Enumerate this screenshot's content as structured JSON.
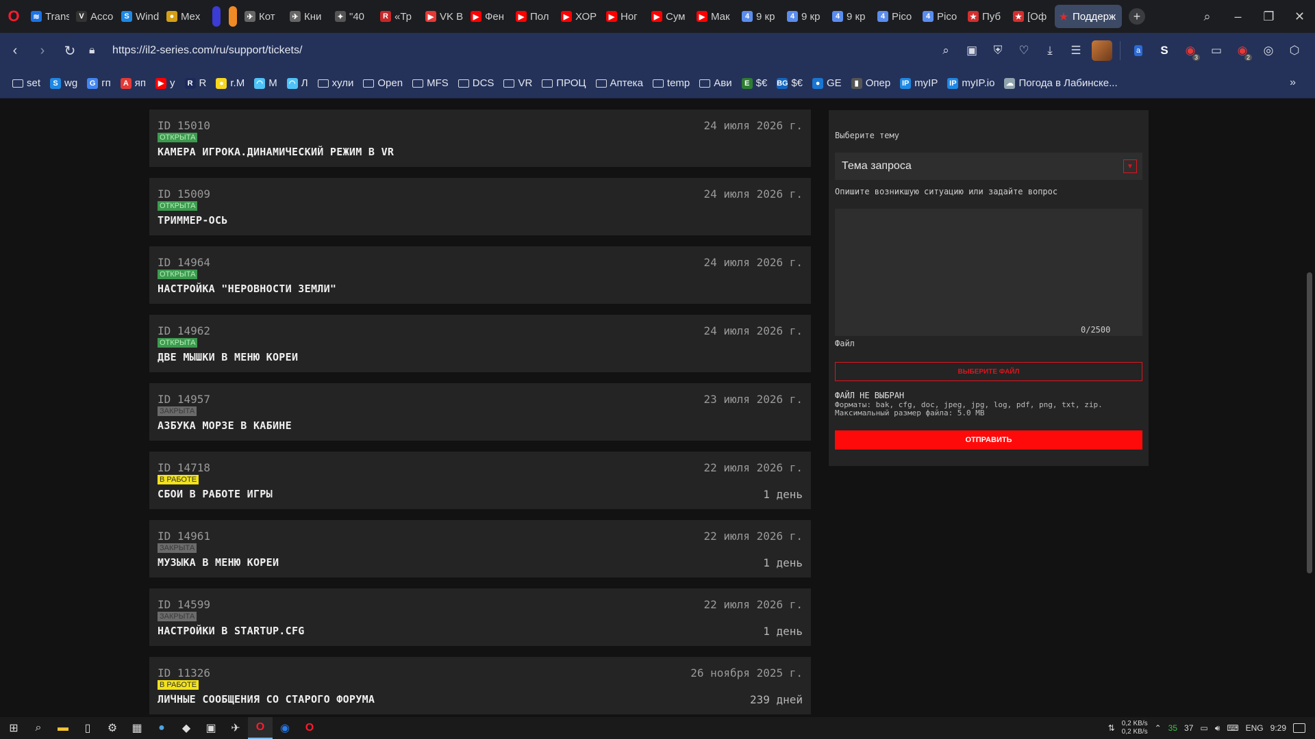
{
  "browser": {
    "tabs": [
      {
        "label": "Trans",
        "icon": "wifi-icon",
        "color": "#1a73e8"
      },
      {
        "label": "Acco",
        "icon": "vpn-icon",
        "color": "#333333"
      },
      {
        "label": "Wind",
        "icon": "wg-icon",
        "color": "#1e88e5"
      },
      {
        "label": "Mex",
        "icon": "coin-icon",
        "color": "#d4a017"
      },
      {
        "label": "",
        "icon": "pill",
        "color": "#3b3bd6"
      },
      {
        "label": "",
        "icon": "pill",
        "color": "#f08a24"
      },
      {
        "label": "Кот",
        "icon": "plane-icon",
        "color": "#666666"
      },
      {
        "label": "Кни",
        "icon": "plane-icon",
        "color": "#666666"
      },
      {
        "label": "\"40",
        "icon": "star4-icon",
        "color": "#555555"
      },
      {
        "label": "«Тр",
        "icon": "r-icon",
        "color": "#c62828"
      },
      {
        "label": "VK В",
        "icon": "play-icon",
        "color": "#e53935"
      },
      {
        "label": "Фен",
        "icon": "youtube-icon",
        "color": "#ff0000"
      },
      {
        "label": "Пол",
        "icon": "youtube-icon",
        "color": "#ff0000"
      },
      {
        "label": "ХОР",
        "icon": "youtube-icon",
        "color": "#ff0000"
      },
      {
        "label": "Ног",
        "icon": "youtube-icon",
        "color": "#ff0000"
      },
      {
        "label": "Сум",
        "icon": "youtube-icon",
        "color": "#ff0000"
      },
      {
        "label": "Мак",
        "icon": "youtube-icon",
        "color": "#ff0000"
      },
      {
        "label": "9 кр",
        "icon": "four-icon",
        "color": "#5b8def"
      },
      {
        "label": "9 кр",
        "icon": "four-icon",
        "color": "#5b8def"
      },
      {
        "label": "9 кр",
        "icon": "four-icon",
        "color": "#5b8def"
      },
      {
        "label": "Pico",
        "icon": "four-icon",
        "color": "#5b8def"
      },
      {
        "label": "Pico",
        "icon": "four-icon",
        "color": "#5b8def"
      },
      {
        "label": "Пуб",
        "icon": "red-star-icon",
        "color": "#d32f2f"
      },
      {
        "label": "[Оф",
        "icon": "red-star-icon",
        "color": "#d32f2f"
      }
    ],
    "active_tab": {
      "label": "Поддерж",
      "icon": "red-star-icon"
    },
    "url": "https://il2-series.com/ru/support/tickets/",
    "extension_badges": {
      "ext1": "3",
      "ext2": "2"
    }
  },
  "bookmarks": [
    {
      "label": "set",
      "type": "folder"
    },
    {
      "label": "wg",
      "type": "icon",
      "color": "#1e88e5",
      "glyph": "S"
    },
    {
      "label": "гп",
      "type": "icon",
      "color": "#4285f4",
      "glyph": "G"
    },
    {
      "label": "яп",
      "type": "icon",
      "color": "#e53935",
      "glyph": "A"
    },
    {
      "label": "у",
      "type": "icon",
      "color": "#ff0000",
      "glyph": "▶"
    },
    {
      "label": "R",
      "type": "icon",
      "color": "#1c2a5a",
      "glyph": "R"
    },
    {
      "label": "r.M",
      "type": "icon",
      "color": "#f9d71c",
      "glyph": "●"
    },
    {
      "label": "М",
      "type": "icon",
      "color": "#4fc3f7",
      "glyph": "◠"
    },
    {
      "label": "Л",
      "type": "icon",
      "color": "#4fc3f7",
      "glyph": "◠"
    },
    {
      "label": "хули",
      "type": "folder"
    },
    {
      "label": "Open",
      "type": "folder"
    },
    {
      "label": "MFS",
      "type": "folder"
    },
    {
      "label": "DCS",
      "type": "folder"
    },
    {
      "label": "VR",
      "type": "folder"
    },
    {
      "label": "ПРОЦ",
      "type": "folder"
    },
    {
      "label": "Аптека",
      "type": "folder"
    },
    {
      "label": "temp",
      "type": "folder"
    },
    {
      "label": "Ави",
      "type": "folder"
    },
    {
      "label": "$€",
      "type": "icon",
      "color": "#2e7d32",
      "glyph": "E"
    },
    {
      "label": "$€",
      "type": "icon",
      "color": "#1565c0",
      "glyph": "BG"
    },
    {
      "label": "GE",
      "type": "icon",
      "color": "#1976d2",
      "glyph": "●"
    },
    {
      "label": "Опер",
      "type": "icon",
      "color": "#555555",
      "glyph": "▮"
    },
    {
      "label": "myIP",
      "type": "icon",
      "color": "#1e88e5",
      "glyph": "IP"
    },
    {
      "label": "myIP.io",
      "type": "icon",
      "color": "#1e88e5",
      "glyph": "IP"
    },
    {
      "label": "Погода в Лабинске...",
      "type": "icon",
      "color": "#90a4ae",
      "glyph": "☁"
    }
  ],
  "tickets": [
    {
      "id": "ID 15010",
      "status": "ОТКРЫТА",
      "status_kind": "open",
      "title": "КАМЕРА ИГРОКА.ДИНАМИЧЕСКИЙ РЕЖИМ В VR",
      "date": "24 июля 2026 г.",
      "age": ""
    },
    {
      "id": "ID 15009",
      "status": "ОТКРЫТА",
      "status_kind": "open",
      "title": "ТРИММЕР-ОСЬ",
      "date": "24 июля 2026 г.",
      "age": ""
    },
    {
      "id": "ID 14964",
      "status": "ОТКРЫТА",
      "status_kind": "open",
      "title": "НАСТРОЙКА \"НЕРОВНОСТИ ЗЕМЛИ\"",
      "date": "24 июля 2026 г.",
      "age": ""
    },
    {
      "id": "ID 14962",
      "status": "ОТКРЫТА",
      "status_kind": "open",
      "title": "ДВЕ МЫШКИ В МЕНЮ КОРЕИ",
      "date": "24 июля 2026 г.",
      "age": ""
    },
    {
      "id": "ID 14957",
      "status": "ЗАКРЫТА",
      "status_kind": "closed",
      "title": "АЗБУКА МОРЗЕ В КАБИНЕ",
      "date": "23 июля 2026 г.",
      "age": ""
    },
    {
      "id": "ID 14718",
      "status": "В РАБОТЕ",
      "status_kind": "work",
      "title": "СБОИ В РАБОТЕ ИГРЫ",
      "date": "22 июля 2026 г.",
      "age": "1 день"
    },
    {
      "id": "ID 14961",
      "status": "ЗАКРЫТА",
      "status_kind": "closed",
      "title": "МУЗЫКА В МЕНЮ КОРЕИ",
      "date": "22 июля 2026 г.",
      "age": "1 день"
    },
    {
      "id": "ID 14599",
      "status": "ЗАКРЫТА",
      "status_kind": "closed",
      "title": "НАСТРОЙКИ В STARTUP.CFG",
      "date": "22 июля 2026 г.",
      "age": "1 день"
    },
    {
      "id": "ID 11326",
      "status": "В РАБОТЕ",
      "status_kind": "work",
      "title": "ЛИЧНЫЕ СООБЩЕНИЯ СО СТАРОГО ФОРУМА",
      "date": "26 ноября 2025 г.",
      "age": "239 дней"
    }
  ],
  "form": {
    "topic_label": "Выберите тему",
    "topic_value": "Тема запроса",
    "question_label": "Опишите возникшую ситуацию или задайте вопрос",
    "char_count": "0/2500",
    "file_label": "Файл",
    "choose_file": "ВЫБЕРИТЕ ФАЙЛ",
    "file_status": "ФАЙЛ НЕ ВЫБРАН",
    "formats": "Форматы: bak, cfg, doc, jpeg, jpg, log, pdf, png, txt, zip.",
    "max_size": "Максимальный размер файла: 5.0 MB",
    "submit": "ОТПРАВИТЬ"
  },
  "colors": {
    "accent_red": "#ff0a0a",
    "status_open": "#3d9b4f",
    "status_closed": "#6b6b6b",
    "status_work": "#f2e21a"
  },
  "taskbar": {
    "net_up": "0,2 KB/s",
    "net_down": "0,2 KB/s",
    "tray_num1": "35",
    "tray_num2": "37",
    "language": "ENG",
    "time": "9:29"
  }
}
